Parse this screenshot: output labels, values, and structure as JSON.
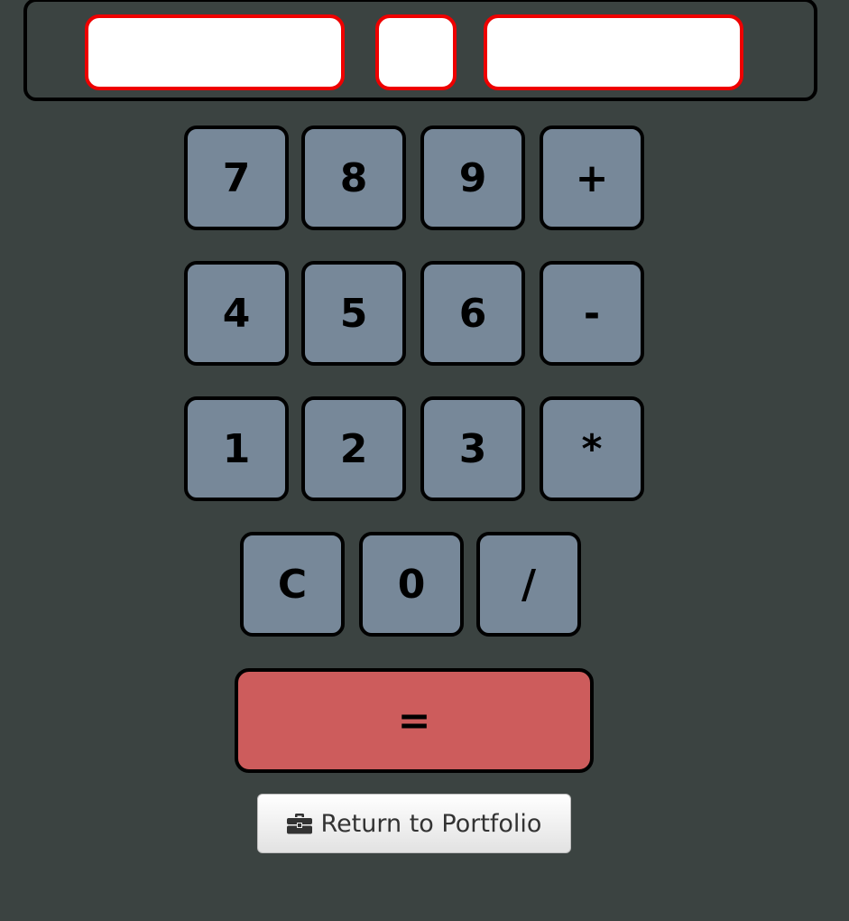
{
  "display": {
    "operand1": "",
    "operator": "",
    "operand2": ""
  },
  "keypad": {
    "row1": [
      "7",
      "8",
      "9",
      "+"
    ],
    "row2": [
      "4",
      "5",
      "6",
      "-"
    ],
    "row3": [
      "1",
      "2",
      "3",
      "*"
    ],
    "row4": [
      "C",
      "0",
      "/"
    ]
  },
  "equals_label": "=",
  "return_button": {
    "label": "Return to Portfolio",
    "icon": "briefcase-icon"
  },
  "colors": {
    "background": "#3b4341",
    "key": "#778899",
    "equals": "#cd5c5c",
    "field_border": "#ee0000"
  }
}
